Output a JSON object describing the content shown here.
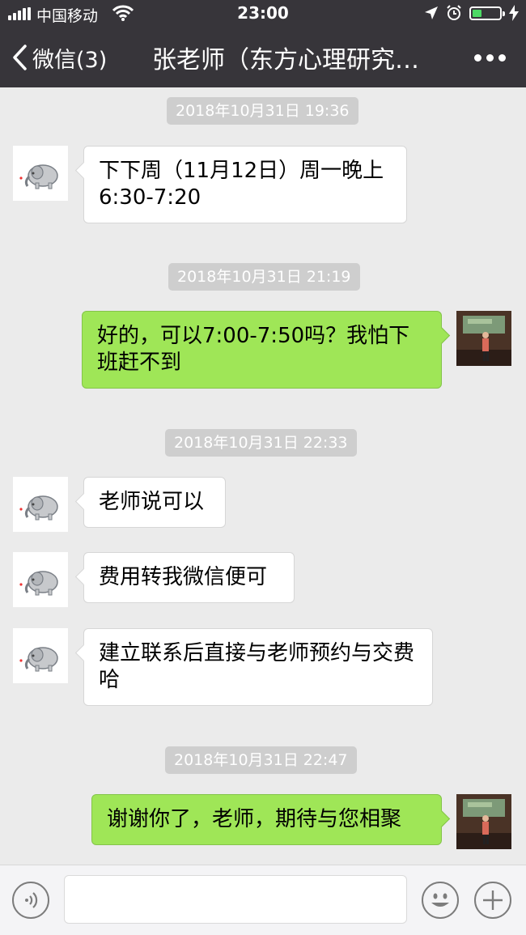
{
  "status_bar": {
    "carrier": "中国移动",
    "time": "23:00"
  },
  "nav": {
    "back_label": "微信(3)",
    "title": "张老师（东方心理研究…"
  },
  "messages": [
    {
      "type": "timestamp",
      "text": "2018年10月31日 19:36"
    },
    {
      "type": "incoming",
      "text": "下下周（11月12日）周一晚上6:30-7:20"
    },
    {
      "type": "timestamp",
      "text": "2018年10月31日 21:19"
    },
    {
      "type": "outgoing",
      "text": "好的，可以7:00-7:50吗？我怕下班赶不到"
    },
    {
      "type": "timestamp",
      "text": "2018年10月31日 22:33"
    },
    {
      "type": "incoming",
      "text": "老师说可以"
    },
    {
      "type": "incoming",
      "text": "费用转我微信便可"
    },
    {
      "type": "incoming",
      "text": "建立联系后直接与老师预约与交费哈"
    },
    {
      "type": "timestamp",
      "text": "2018年10月31日 22:47"
    },
    {
      "type": "outgoing",
      "text": "谢谢你了，老师，期待与您相聚"
    }
  ],
  "input_bar": {
    "placeholder": ""
  },
  "colors": {
    "nav_bg": "#37353a",
    "chat_bg": "#ebebeb",
    "outgoing_bubble": "#9fe657",
    "incoming_bubble": "#ffffff",
    "timestamp_bg": "#cecece",
    "battery_fill": "#4cd964"
  },
  "icons": {
    "back": "chevron-left-icon",
    "more": "more-dots-icon",
    "voice": "voice-icon",
    "emoji": "emoji-icon",
    "add": "plus-icon",
    "contact_avatar": "elephant-avatar",
    "self_avatar": "photo-avatar"
  }
}
